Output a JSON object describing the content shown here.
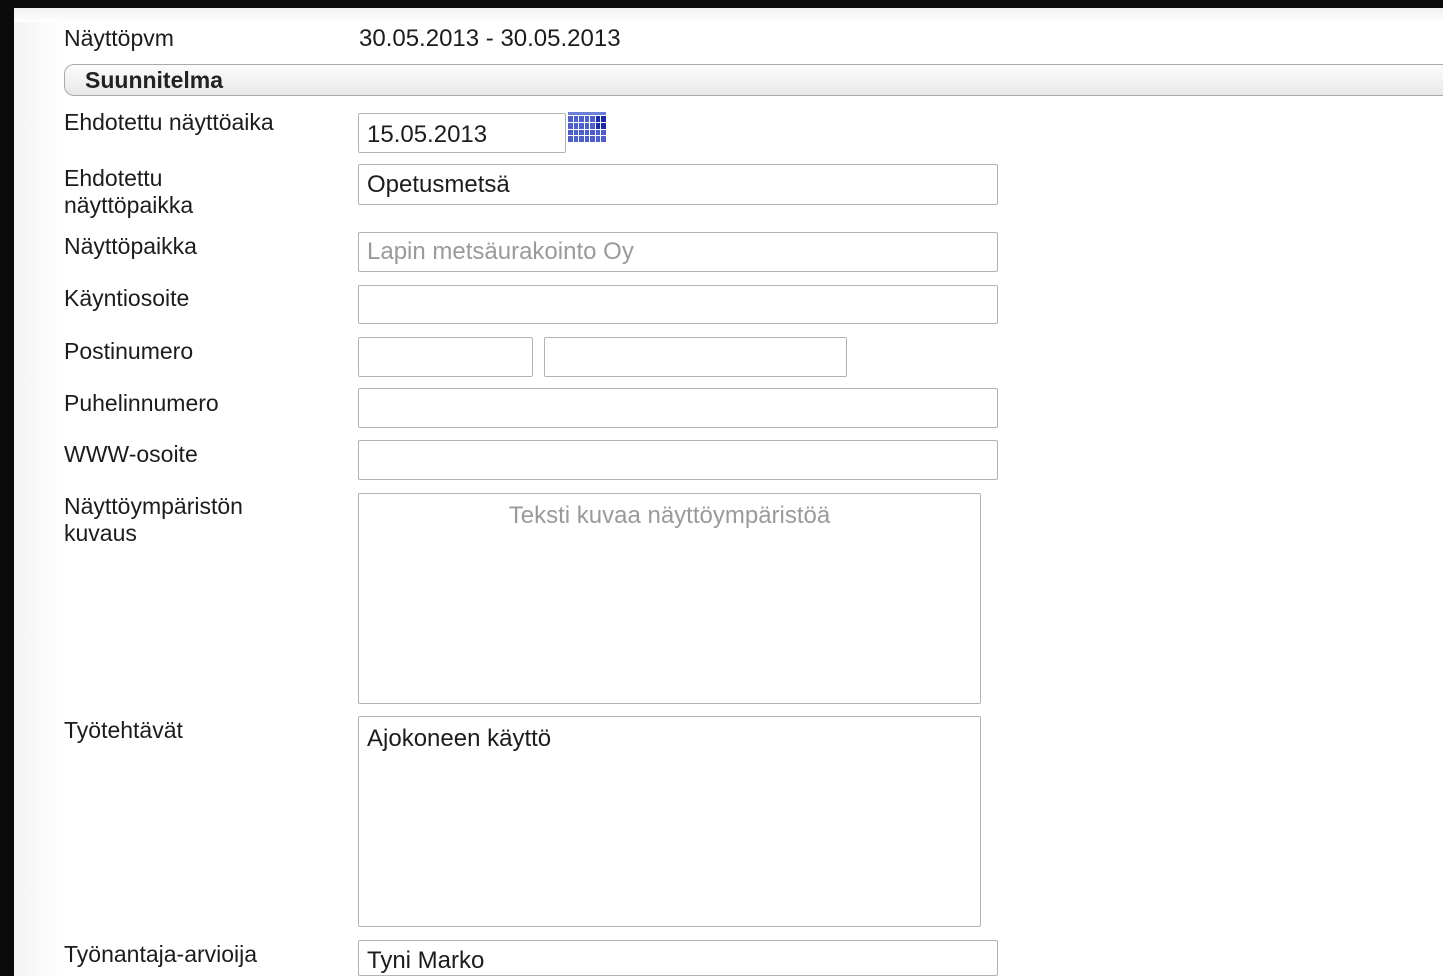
{
  "header": {
    "date_label": "Näyttöpvm",
    "date_value": "30.05.2013 - 30.05.2013"
  },
  "section": {
    "title": "Suunnitelma"
  },
  "form": {
    "proposed_time": {
      "label": "Ehdotettu näyttöaika",
      "value": "15.05.2013"
    },
    "proposed_place": {
      "label_line1": "Ehdotettu",
      "label_line2": "näyttöpaikka",
      "value": "Opetusmetsä"
    },
    "place": {
      "label": "Näyttöpaikka",
      "value": "",
      "placeholder": "Lapin metsäurakointo Oy"
    },
    "visit_address": {
      "label": "Käyntiosoite",
      "value": ""
    },
    "postal_code": {
      "label": "Postinumero",
      "code_value": "",
      "city_value": ""
    },
    "phone": {
      "label": "Puhelinnumero",
      "value": ""
    },
    "www": {
      "label": "WWW-osoite",
      "value": ""
    },
    "environment": {
      "label_line1": "Näyttöympäristön",
      "label_line2": "kuvaus",
      "value": "",
      "placeholder": "Teksti kuvaa näyttöympäristöä"
    },
    "tasks": {
      "label": "Työtehtävät",
      "value": "Ajokoneen käyttö"
    },
    "employer_assessor": {
      "label": "Työnantaja-arvioija",
      "value": "Tyni Marko"
    }
  },
  "icons": {
    "calendar": "calendar-icon"
  },
  "colors": {
    "calendar_blue": "#4d5fce",
    "frame": "#0b0b0b",
    "field_border": "#b3b3b3",
    "placeholder": "#9a9a9a"
  }
}
